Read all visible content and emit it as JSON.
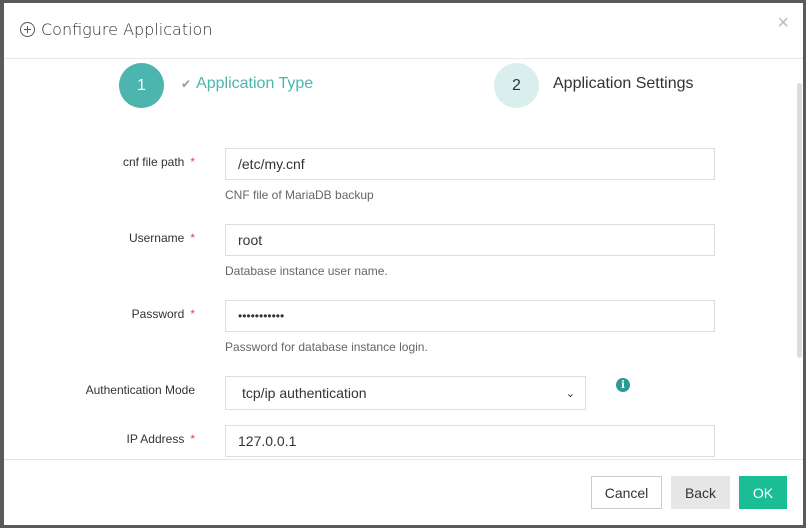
{
  "dialog": {
    "title": "Configure Application",
    "close_label": "×"
  },
  "steps": [
    {
      "number": "1",
      "label": "Application Type",
      "state": "completed"
    },
    {
      "number": "2",
      "label": "Application Settings",
      "state": "current"
    }
  ],
  "form": {
    "cnf_path": {
      "label": "cnf file path",
      "required": "*",
      "value": "/etc/my.cnf",
      "help": "CNF file of MariaDB backup"
    },
    "username": {
      "label": "Username",
      "required": "*",
      "value": "root",
      "help": "Database instance user name."
    },
    "password": {
      "label": "Password",
      "required": "*",
      "value": "•••••••••••",
      "help": "Password for database instance login."
    },
    "auth_mode": {
      "label": "Authentication Mode",
      "value": "tcp/ip authentication",
      "info_icon": "i"
    },
    "ip_address": {
      "label": "IP Address",
      "required": "*",
      "value": "127.0.0.1"
    }
  },
  "footer": {
    "cancel": "Cancel",
    "back": "Back",
    "ok": "OK"
  },
  "colors": {
    "accent": "#4bb5ae",
    "ok_button": "#1bbd95",
    "required": "#e0474c"
  }
}
